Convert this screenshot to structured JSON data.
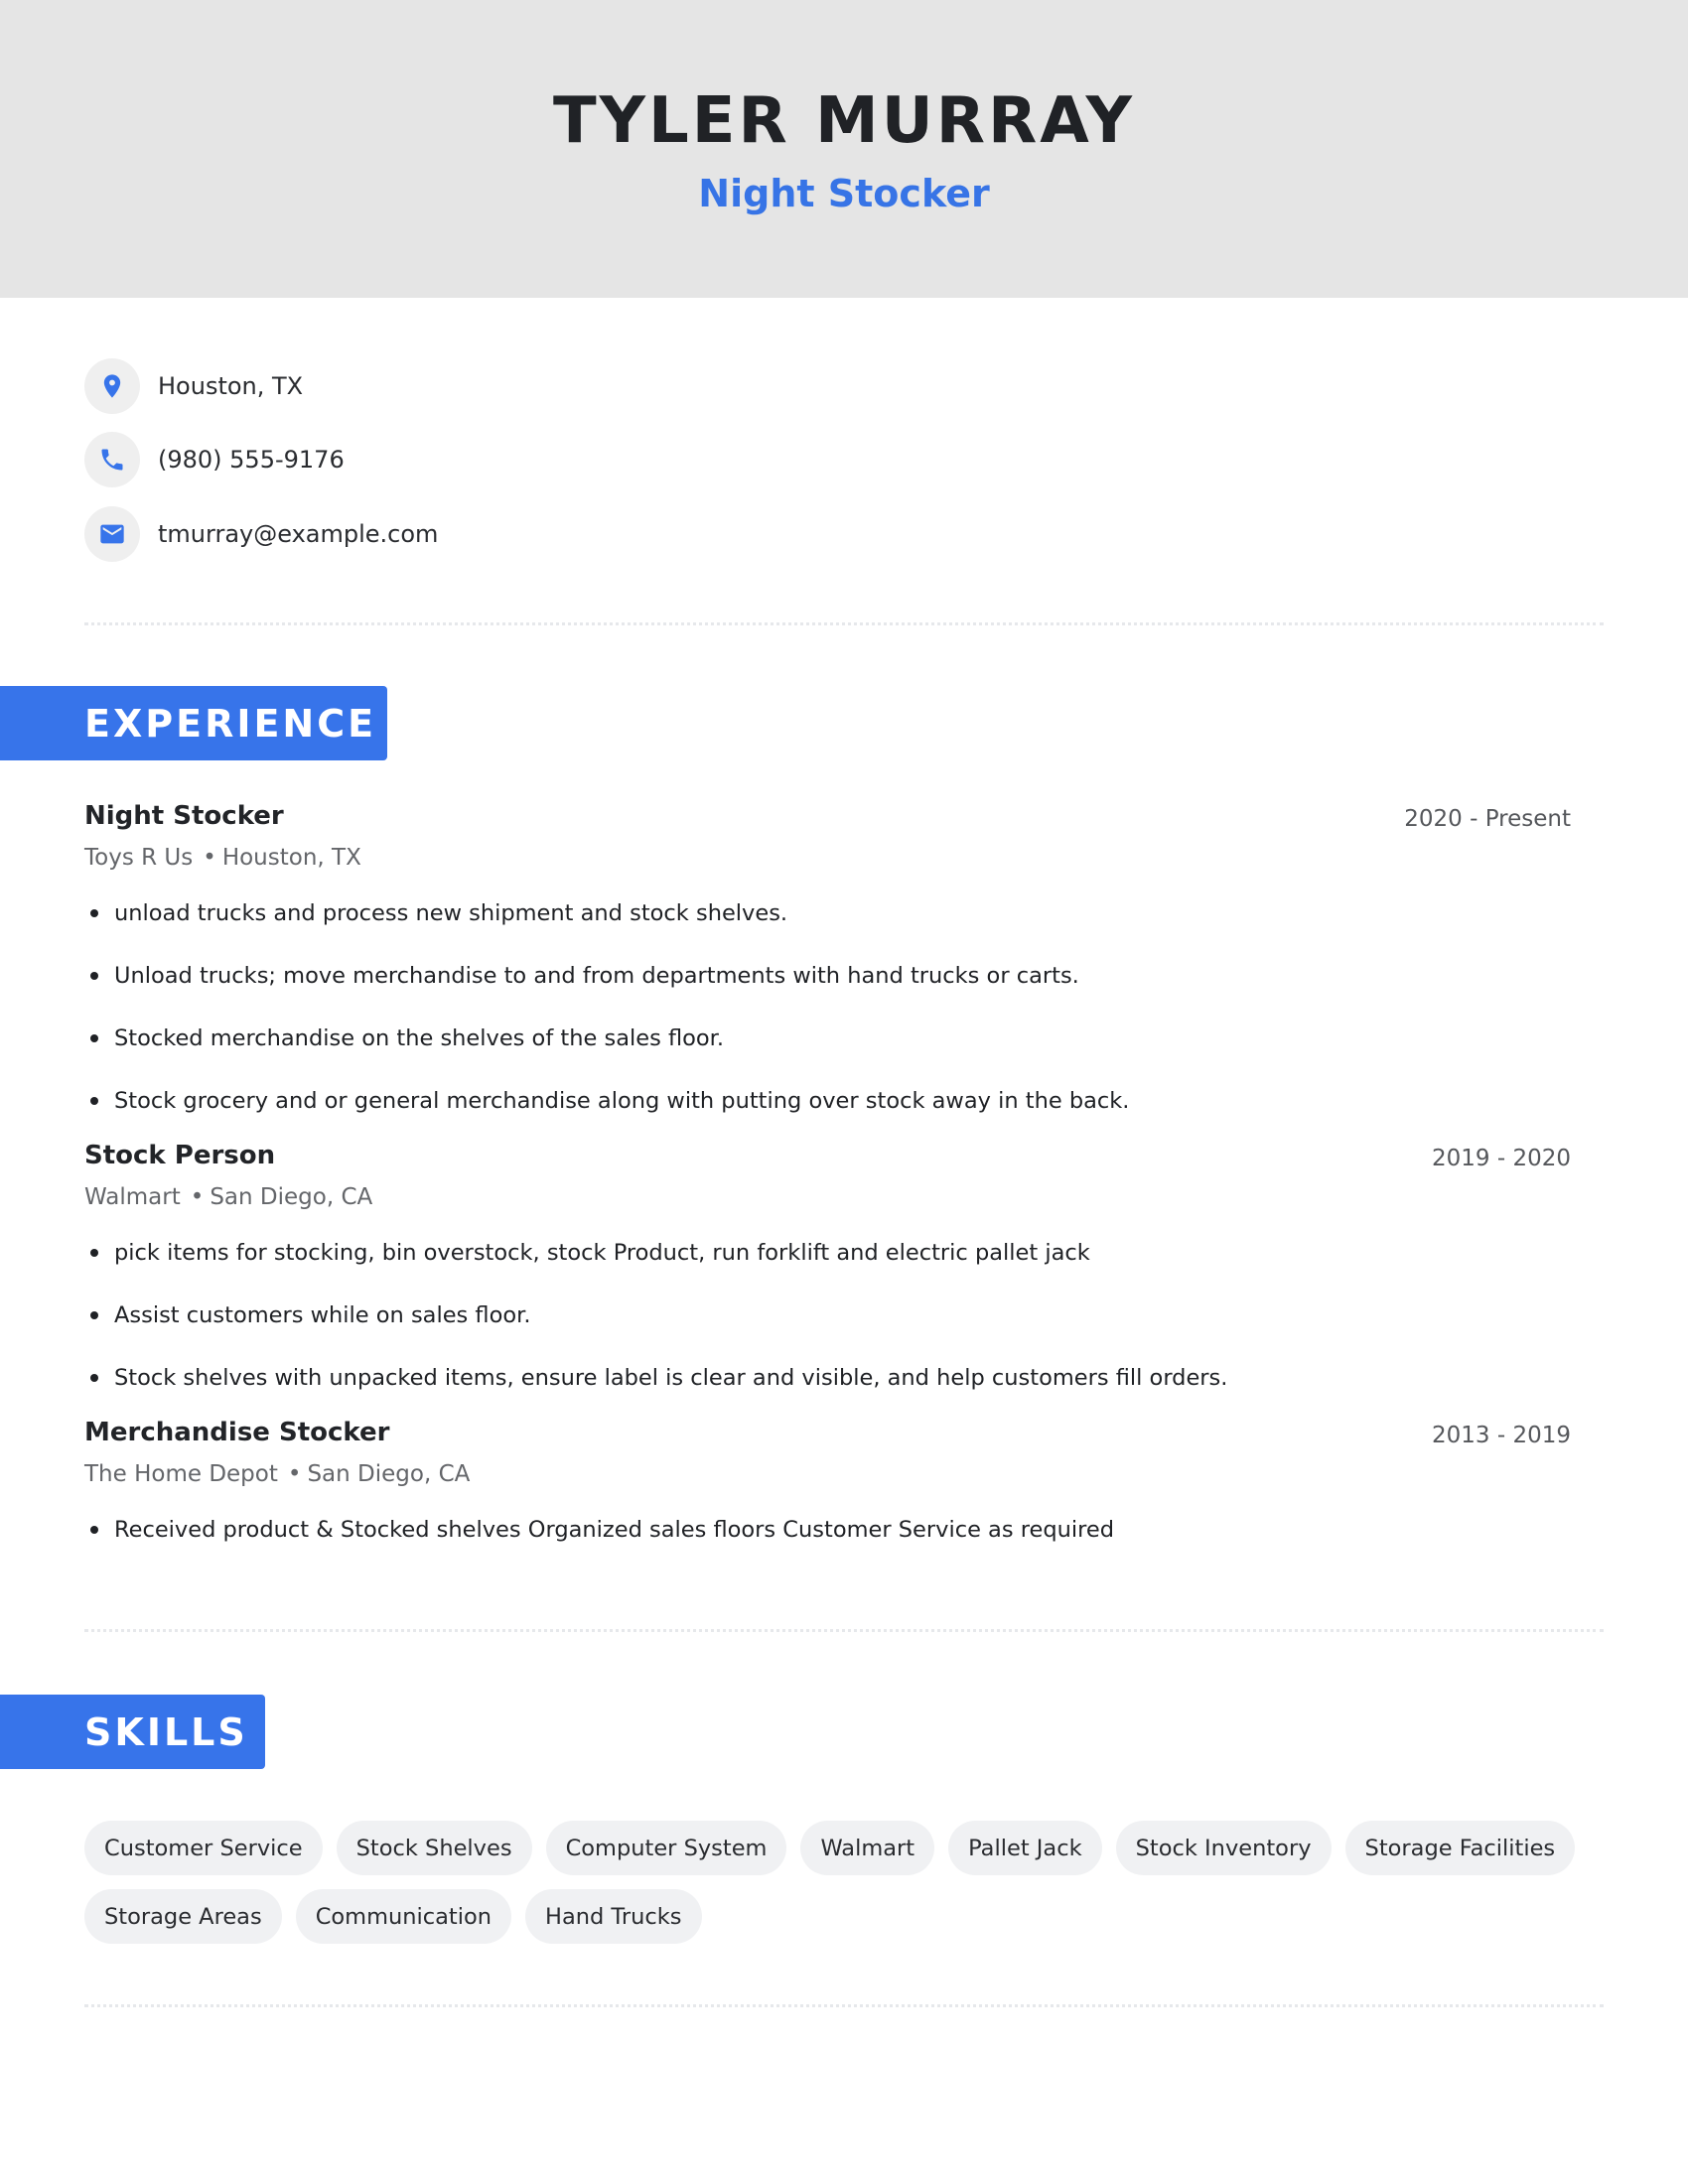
{
  "header": {
    "name": "TYLER MURRAY",
    "title": "Night Stocker"
  },
  "contact": [
    {
      "icon": "location-pin-icon",
      "text": "Houston, TX"
    },
    {
      "icon": "phone-icon",
      "text": "(980) 555-9176"
    },
    {
      "icon": "email-icon",
      "text": "tmurray@example.com"
    }
  ],
  "colors": {
    "accent": "#3774ea",
    "header_bg": "#e5e5e5",
    "pill_bg": "#f0f1f3"
  },
  "experience": {
    "heading": "EXPERIENCE",
    "jobs": [
      {
        "title": "Night Stocker",
        "dates": "2020 - Present",
        "company": "Toys R Us",
        "location": "Houston, TX",
        "bullets": [
          "unload trucks and process new shipment and stock shelves.",
          "Unload trucks; move merchandise to and from departments with hand trucks or carts.",
          "Stocked merchandise on the shelves of the sales floor.",
          "Stock grocery and or general merchandise along with putting over stock away in the back."
        ]
      },
      {
        "title": "Stock Person",
        "dates": "2019 - 2020",
        "company": "Walmart",
        "location": "San Diego, CA",
        "bullets": [
          "pick items for stocking, bin overstock, stock Product, run forklift and electric pallet jack",
          "Assist customers while on sales floor.",
          "Stock shelves with unpacked items, ensure label is clear and visible, and help customers fill orders."
        ]
      },
      {
        "title": "Merchandise Stocker",
        "dates": "2013 - 2019",
        "company": "The Home Depot",
        "location": "San Diego, CA",
        "bullets": [
          "Received product & Stocked shelves Organized sales floors Customer Service as required"
        ]
      }
    ]
  },
  "skills": {
    "heading": "SKILLS",
    "items": [
      "Customer Service",
      "Stock Shelves",
      "Computer System",
      "Walmart",
      "Pallet Jack",
      "Stock Inventory",
      "Storage Facilities",
      "Storage Areas",
      "Communication",
      "Hand Trucks"
    ]
  },
  "separator": "•"
}
